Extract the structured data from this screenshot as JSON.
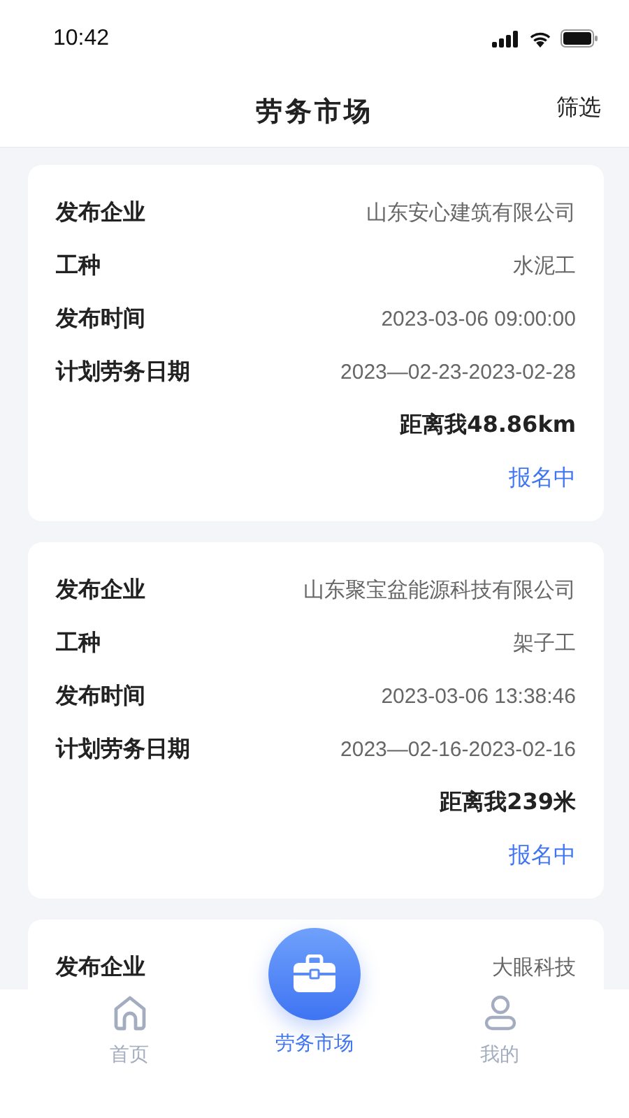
{
  "status_bar": {
    "time": "10:42"
  },
  "header": {
    "title": "劳务市场",
    "action": "筛选"
  },
  "cards": [
    {
      "rows": [
        {
          "label": "发布企业",
          "value": "山东安心建筑有限公司"
        },
        {
          "label": "工种",
          "value": "水泥工"
        },
        {
          "label": "发布时间",
          "value": "2023-03-06 09:00:00"
        },
        {
          "label": "计划劳务日期",
          "value": "2023—02-23-2023-02-28"
        }
      ],
      "distance": "距离我48.86km",
      "status": "报名中"
    },
    {
      "rows": [
        {
          "label": "发布企业",
          "value": "山东聚宝盆能源科技有限公司"
        },
        {
          "label": "工种",
          "value": "架子工"
        },
        {
          "label": "发布时间",
          "value": "2023-03-06 13:38:46"
        },
        {
          "label": "计划劳务日期",
          "value": "2023—02-16-2023-02-16"
        }
      ],
      "distance": "距离我239米",
      "status": "报名中"
    },
    {
      "rows": [
        {
          "label": "发布企业",
          "value": "大眼科技"
        }
      ]
    }
  ],
  "tab_bar": [
    {
      "kind": "home",
      "label": "首页",
      "selected": false
    },
    {
      "kind": "center",
      "label": "劳务市场",
      "selected": true
    },
    {
      "kind": "profile",
      "label": "我的",
      "selected": false
    }
  ]
}
